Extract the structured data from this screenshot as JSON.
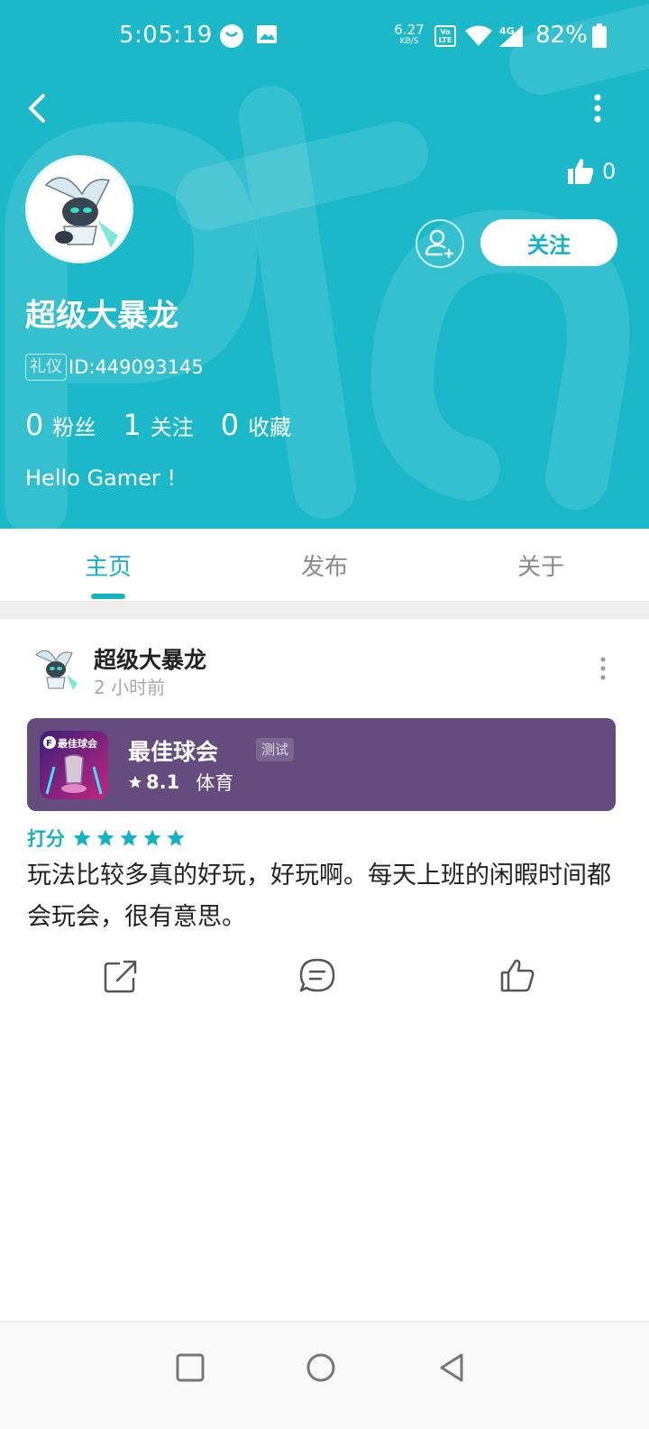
{
  "status_bar": {
    "time": "5:05:19",
    "net_speed_value": "6.27",
    "net_speed_unit": "KB/S",
    "lte_badge_top": "Vo",
    "lte_badge_bottom": "LTE",
    "network_type": "4G",
    "battery_percent": "82%"
  },
  "header": {
    "like_count": "0",
    "follow_label": "关注",
    "username": "超级大暴龙",
    "id_badge": "礼仪",
    "id_text": "ID:449093145",
    "bio": "Hello Gamer !"
  },
  "stats": [
    {
      "count": "0",
      "label": "粉丝"
    },
    {
      "count": "1",
      "label": "关注"
    },
    {
      "count": "0",
      "label": "收藏"
    }
  ],
  "tabs": [
    {
      "label": "主页",
      "active": true
    },
    {
      "label": "发布",
      "active": false
    },
    {
      "label": "关于",
      "active": false
    }
  ],
  "post": {
    "author": "超级大暴龙",
    "time_ago": "2 小时前",
    "game": {
      "name": "最佳球会",
      "tag": "测试",
      "rating": "8.1",
      "category": "体育",
      "icon_text": "最佳球会"
    },
    "score_label": "打分",
    "stars": 5,
    "content": "玩法比较多真的好玩，好玩啊。每天上班的闲暇时间都会玩会，很有意思。"
  },
  "colors": {
    "header_bg": "#1ab8c9",
    "accent": "#16b1c3",
    "game_card_bg": "#644c7f"
  }
}
